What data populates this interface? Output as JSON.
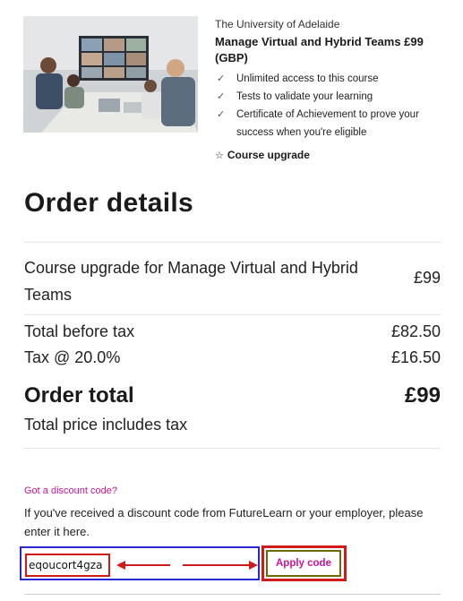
{
  "course": {
    "provider": "The University of Adelaide",
    "title": "Manage Virtual and Hybrid Teams £99 (GBP)",
    "benefits": [
      "Unlimited access to this course",
      "Tests to validate your learning",
      "Certificate of Achievement to prove your success when you're eligible"
    ],
    "upgrade_label": "Course upgrade",
    "image_icon": "meeting-photo"
  },
  "order": {
    "heading": "Order details",
    "item": {
      "description": "Course upgrade for Manage Virtual and Hybrid Teams",
      "price": "£99"
    },
    "total_before_tax": {
      "label": "Total before tax",
      "amount": "£82.50"
    },
    "tax": {
      "label": "Tax @ 20.0%",
      "amount": "£16.50"
    },
    "order_total": {
      "label": "Order total",
      "amount": "£99"
    },
    "tax_note": "Total price includes tax"
  },
  "discount": {
    "link_label": "Got a discount code?",
    "description": "If you've received a discount code from FutureLearn or your employer, please enter it here.",
    "code_value": "eqoucort4gza",
    "apply_label": "Apply code"
  },
  "colors": {
    "accent": "#c8139b",
    "annotation_red": "#d11a1a",
    "annotation_blue": "#2727d6"
  }
}
